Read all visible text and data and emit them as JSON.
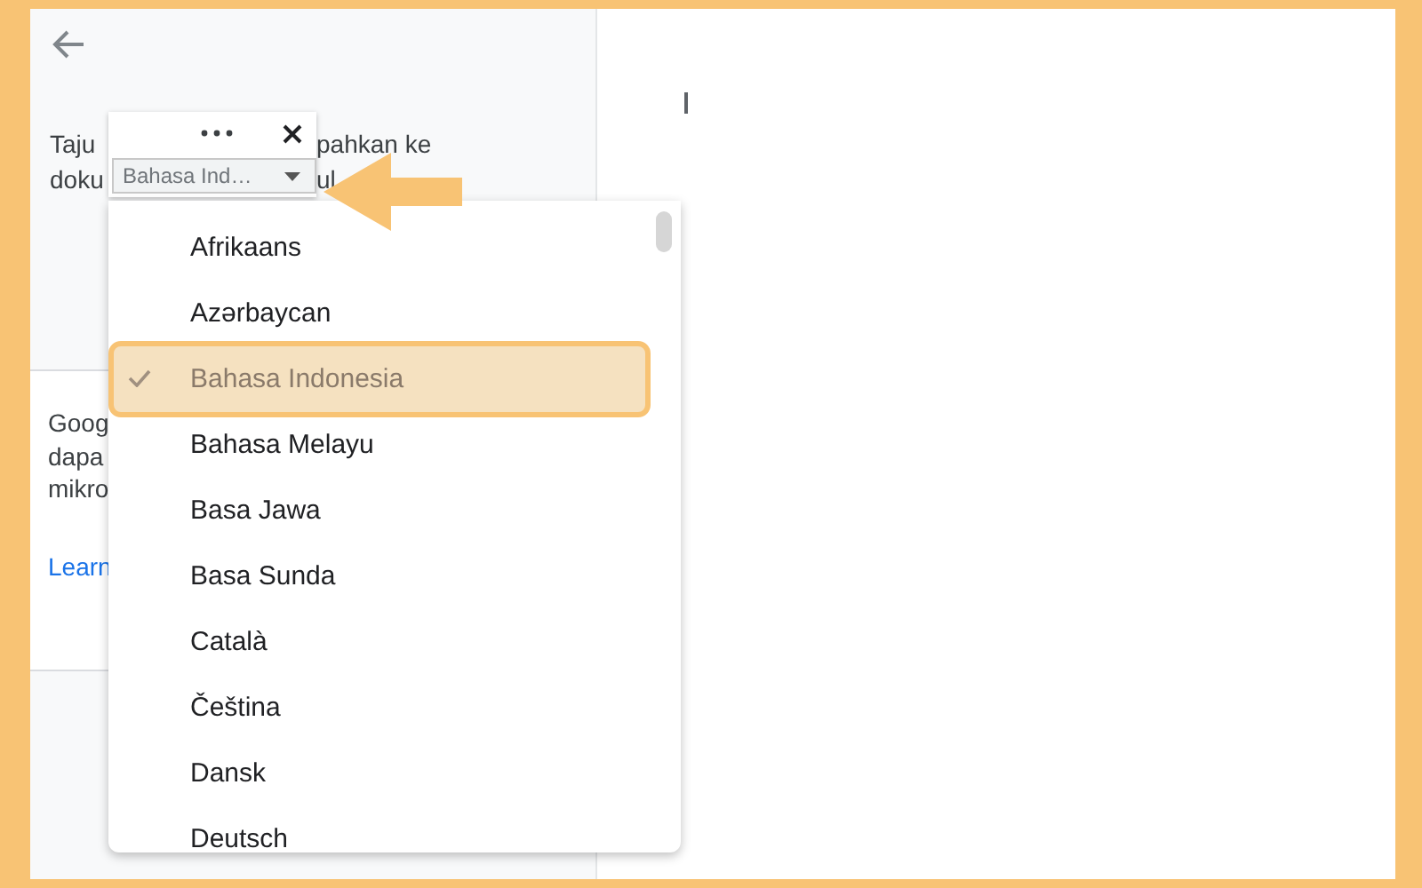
{
  "panel": {
    "intro_left": [
      "Taju",
      "doku"
    ],
    "intro_right": [
      "pahkan ke",
      "ul"
    ],
    "card_lines": [
      "Goog",
      "dapa",
      "mikro"
    ],
    "card_link": "Learn"
  },
  "popup": {
    "language_select": {
      "value": "Bahasa Ind…"
    }
  },
  "language_menu": {
    "items": [
      {
        "label": "Afrikaans",
        "selected": false
      },
      {
        "label": "Azərbaycan",
        "selected": false
      },
      {
        "label": "Bahasa Indonesia",
        "selected": true
      },
      {
        "label": "Bahasa Melayu",
        "selected": false
      },
      {
        "label": "Basa Jawa",
        "selected": false
      },
      {
        "label": "Basa Sunda",
        "selected": false
      },
      {
        "label": "Català",
        "selected": false
      },
      {
        "label": "Čeština",
        "selected": false
      },
      {
        "label": "Dansk",
        "selected": false
      },
      {
        "label": "Deutsch",
        "selected": false
      }
    ]
  }
}
